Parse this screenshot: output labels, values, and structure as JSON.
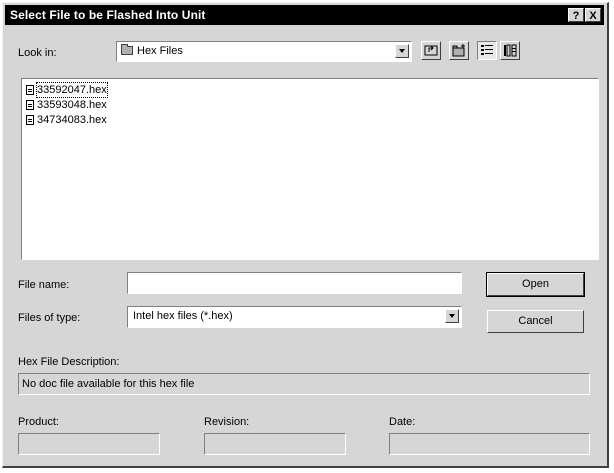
{
  "window": {
    "title": "Select File to be Flashed Into Unit",
    "help_label": "?",
    "close_label": "X"
  },
  "lookin": {
    "label": "Look in:",
    "value": "Hex Files"
  },
  "toolbar": {
    "icons": [
      "up-one-level-icon",
      "create-new-folder-icon",
      "list-view-icon",
      "details-view-icon"
    ]
  },
  "files": [
    {
      "name": "33592047.hex",
      "selected": true
    },
    {
      "name": "33593048.hex",
      "selected": false
    },
    {
      "name": "34734083.hex",
      "selected": false
    }
  ],
  "filename": {
    "label": "File name:",
    "value": ""
  },
  "filetype": {
    "label": "Files of type:",
    "value": "Intel hex files (*.hex)"
  },
  "buttons": {
    "open": "Open",
    "cancel": "Cancel"
  },
  "description": {
    "label": "Hex File Description:",
    "value": "No doc file available for this hex file"
  },
  "product": {
    "label": "Product:",
    "value": ""
  },
  "revision": {
    "label": "Revision:",
    "value": ""
  },
  "date": {
    "label": "Date:",
    "value": ""
  }
}
